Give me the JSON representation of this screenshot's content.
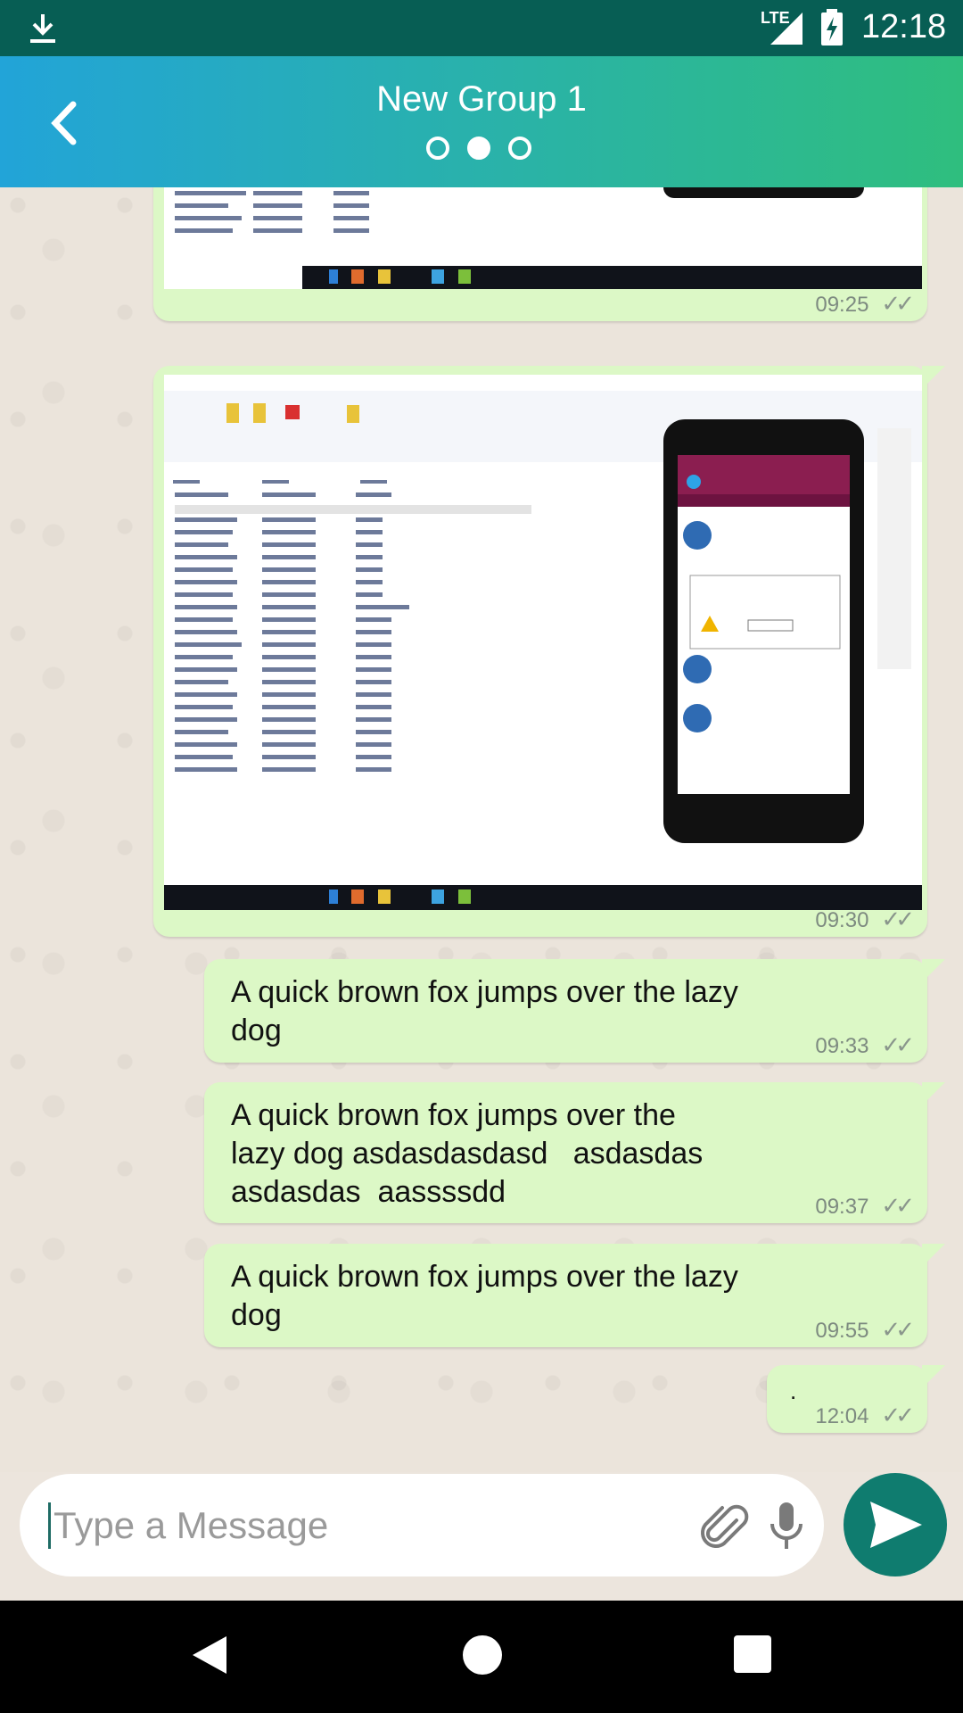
{
  "status_bar": {
    "network": "LTE",
    "time": "12:18"
  },
  "header": {
    "title": "New Group 1",
    "page_dots": [
      false,
      true,
      false
    ]
  },
  "messages": [
    {
      "type": "image",
      "time": "09:25",
      "ticks": "✓✓"
    },
    {
      "type": "image",
      "time": "09:30",
      "ticks": "✓✓"
    },
    {
      "type": "text",
      "text": "A quick brown fox jumps over the lazy\ndog",
      "time": "09:33",
      "ticks": "✓✓"
    },
    {
      "type": "text",
      "text": "A quick brown fox jumps over the\nlazy dog asdasdasdasd   asdasdas\nasdasdas  aassssdd",
      "time": "09:37",
      "ticks": "✓✓"
    },
    {
      "type": "text",
      "text": "A quick brown fox jumps over the lazy\ndog",
      "time": "09:55",
      "ticks": "✓✓"
    },
    {
      "type": "text",
      "text": ".",
      "time": "12:04",
      "ticks": "✓✓"
    }
  ],
  "composer": {
    "placeholder": "Type a Message",
    "value": ""
  },
  "icons": {
    "download": "download-icon",
    "signal": "signal-icon",
    "battery": "battery-charging-icon",
    "back": "chevron-left-icon",
    "attach": "paperclip-icon",
    "mic": "microphone-icon",
    "send": "send-icon"
  },
  "colors": {
    "status_bar": "#075e54",
    "bubble": "#dcf8c6",
    "send": "#0f7c6f",
    "background": "#ece5dd"
  }
}
